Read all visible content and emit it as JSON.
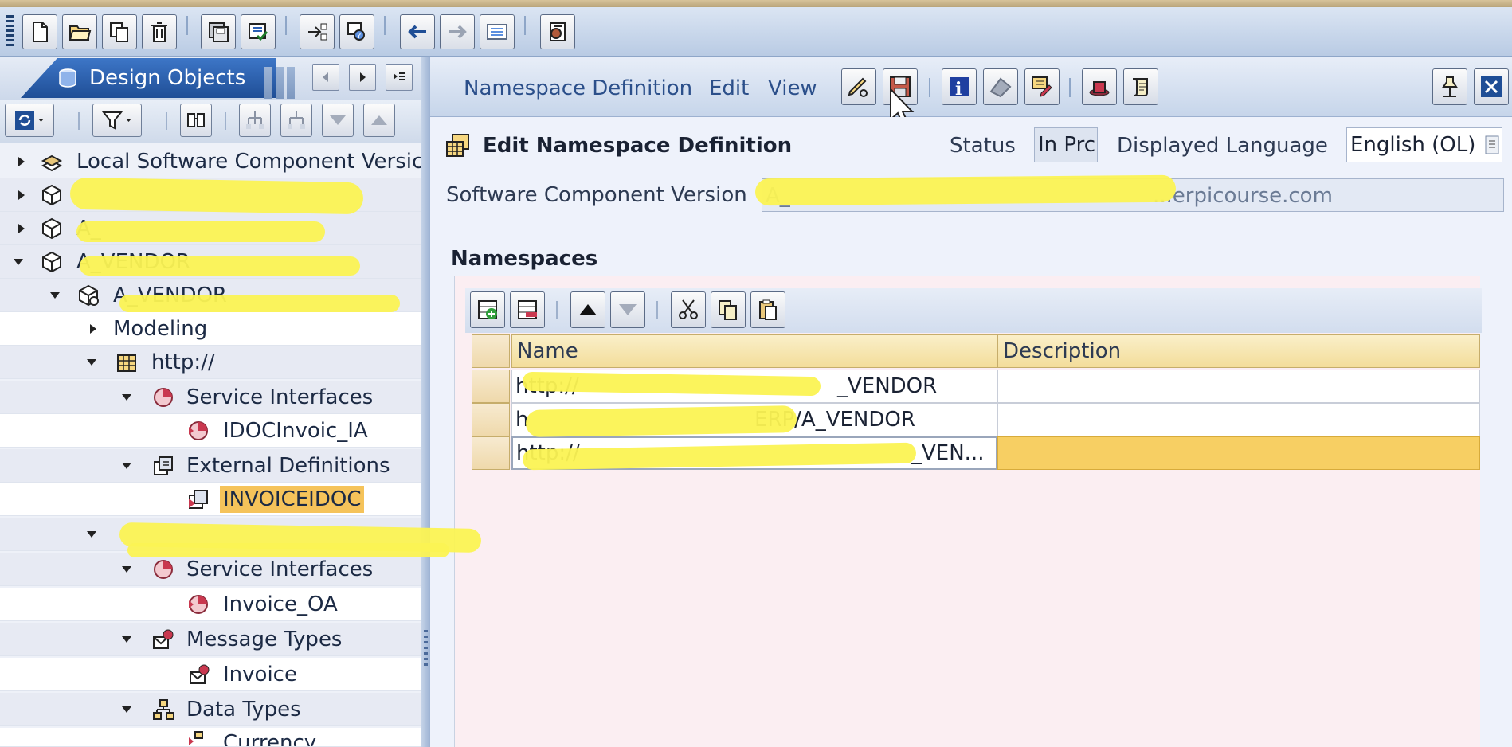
{
  "left_panel": {
    "tab_label": "Design Objects",
    "tree": [
      {
        "label": "Local Software Component Versic",
        "level": 0,
        "expanded": false
      },
      {
        "label": "",
        "level": 0,
        "expanded": false
      },
      {
        "label": "A_",
        "level": 0,
        "expanded": false
      },
      {
        "label": "A_VENDOR",
        "level": 0,
        "expanded": true
      },
      {
        "label": "A_VENDOR",
        "level": 1,
        "expanded": true
      },
      {
        "label": "Modeling",
        "level": 2,
        "expanded": false
      },
      {
        "label": "http://",
        "level": 2,
        "expanded": true
      },
      {
        "label": "Service Interfaces",
        "level": 3,
        "expanded": true
      },
      {
        "label": "IDOCInvoic_IA",
        "level": 4
      },
      {
        "label": "External Definitions",
        "level": 3,
        "expanded": true
      },
      {
        "label": "INVOICEIDOC",
        "level": 4,
        "selected": true
      },
      {
        "label": "",
        "level": 2,
        "expanded": true
      },
      {
        "label": "Service Interfaces",
        "level": 3,
        "expanded": true
      },
      {
        "label": "Invoice_OA",
        "level": 4
      },
      {
        "label": "Message Types",
        "level": 3,
        "expanded": true
      },
      {
        "label": "Invoice",
        "level": 4
      },
      {
        "label": "Data Types",
        "level": 3,
        "expanded": true
      },
      {
        "label": "Currency",
        "level": 4
      }
    ]
  },
  "editor": {
    "menu": [
      "Namespace Definition",
      "Edit",
      "View"
    ],
    "title": "Edit Namespace Definition",
    "status_label": "Status",
    "status_value": "In Prc",
    "language_label": "Displayed Language",
    "language_value": "English (OL)",
    "scv_label": "Software Component Version",
    "scv_value": "A_",
    "scv_value_tail": "...erpicourse.com",
    "namespaces_title": "Namespaces",
    "columns": [
      "Name",
      "Description"
    ],
    "rows": [
      {
        "name": "http://",
        "name_tail": "_VENDOR",
        "description": ""
      },
      {
        "name": "h",
        "name_tail": "ERP/A_VENDOR",
        "description": ""
      },
      {
        "name": "http://",
        "name_tail": "_VEN...",
        "description": ""
      }
    ]
  },
  "icons": {
    "main_toolbar": [
      "new-document-icon",
      "open-folder-icon",
      "copy-icon",
      "delete-icon",
      "save-all-icon",
      "check-icon",
      "navigate-icon",
      "search-object-icon",
      "back-arrow-icon",
      "forward-arrow-icon",
      "list-icon",
      "settings-icon"
    ],
    "accent_color": "#1f4e96",
    "selection_color": "#f5c35a"
  }
}
